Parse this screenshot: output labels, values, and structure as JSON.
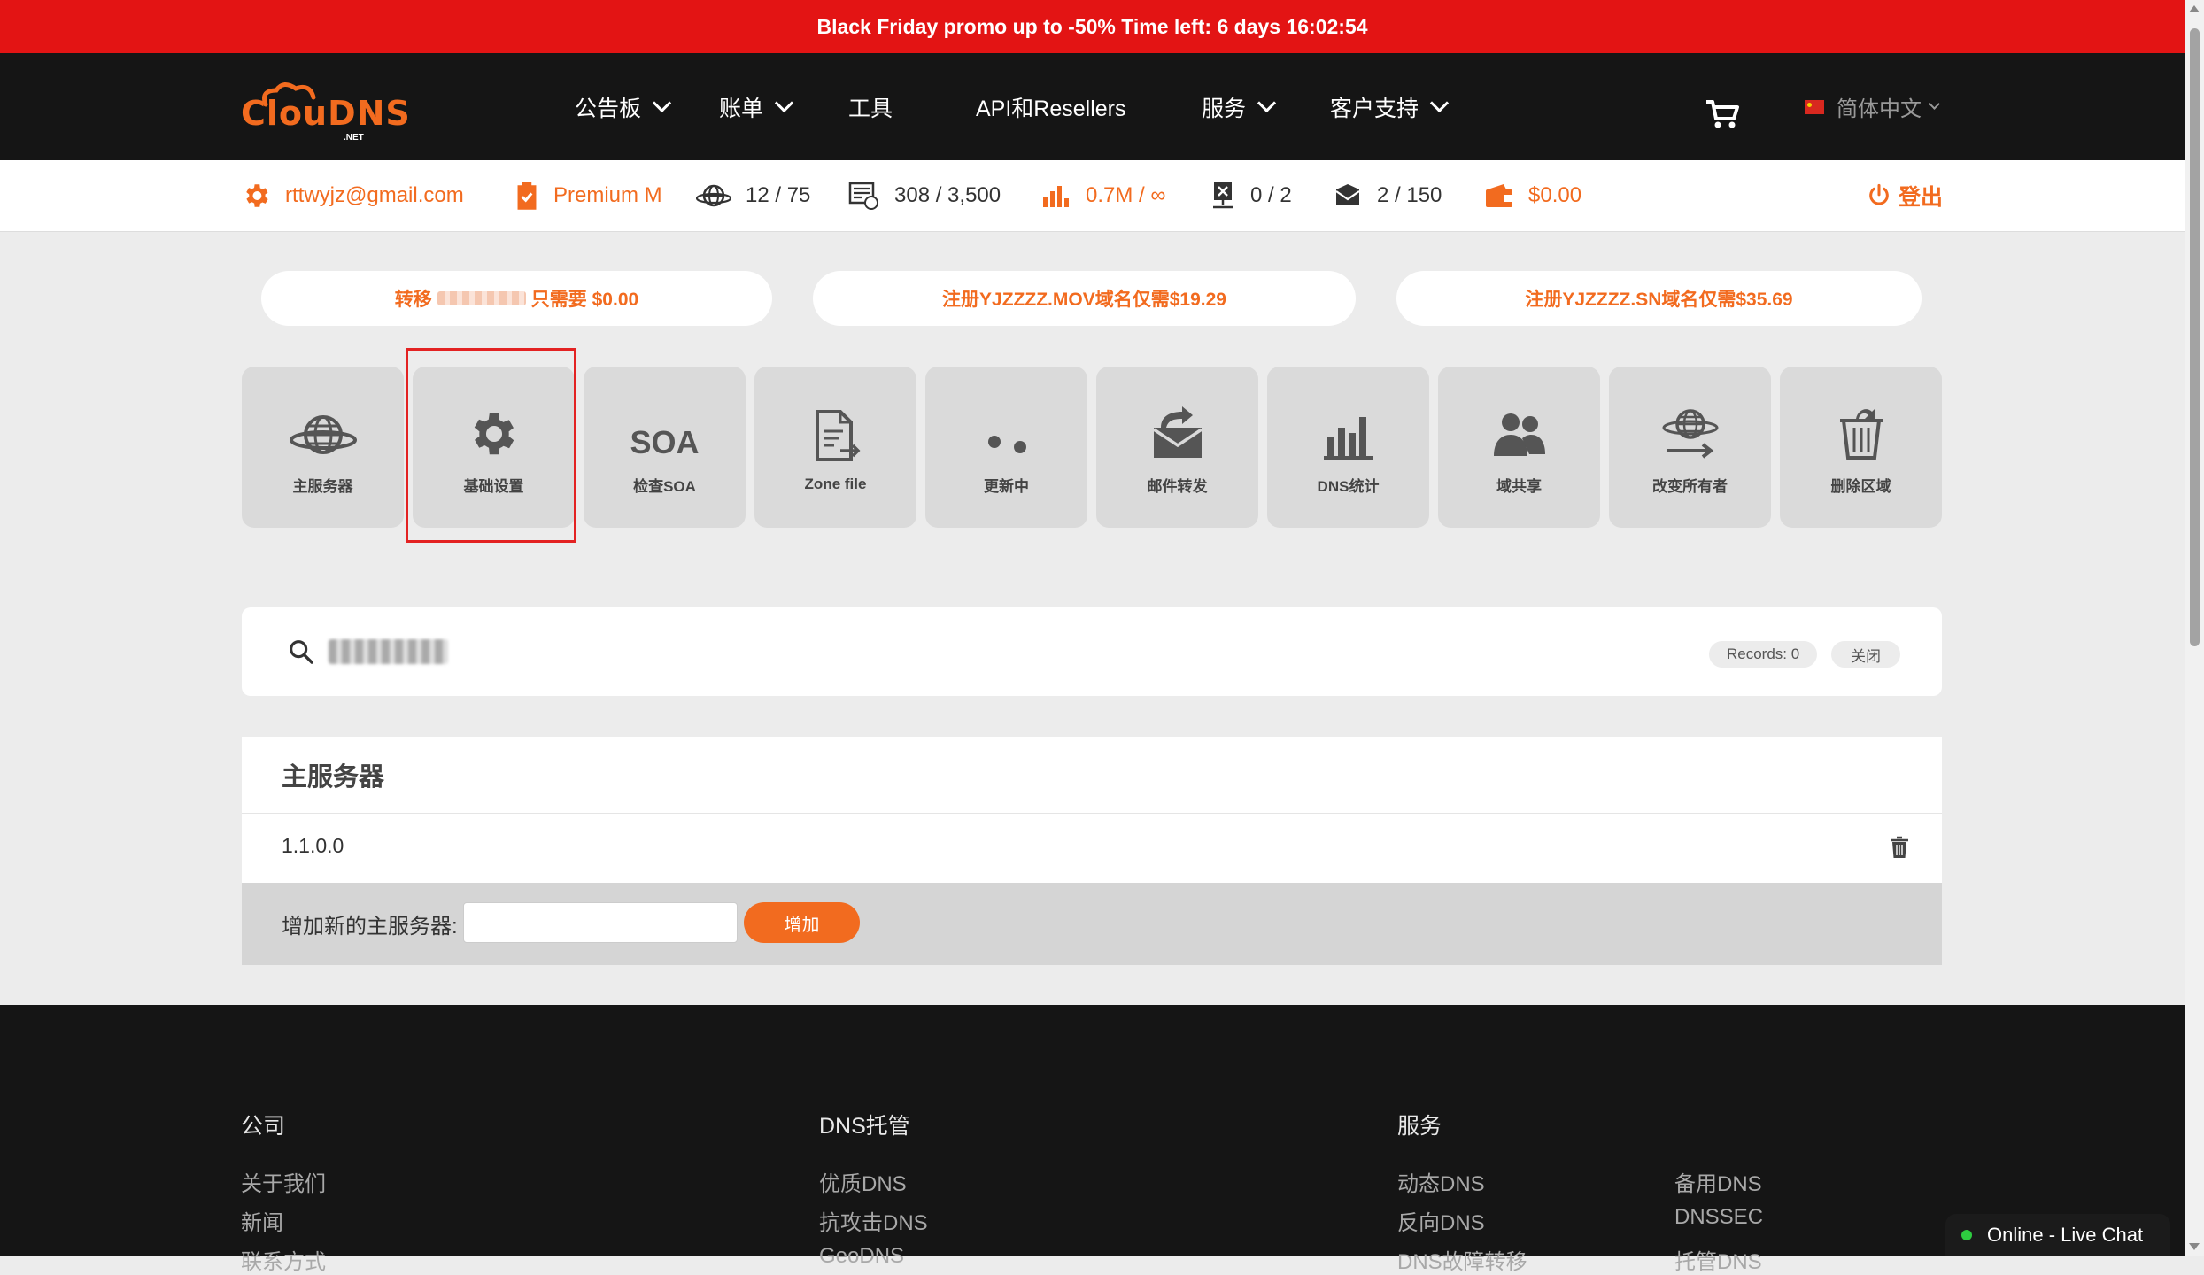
{
  "promo": {
    "text": "Black Friday promo up to -50% Time left: 6 days 16:02:54"
  },
  "logo": {
    "text": "ClouDNS",
    "sub": ".NET"
  },
  "nav": {
    "items": [
      {
        "label": "公告板"
      },
      {
        "label": "账单"
      },
      {
        "label": "工具"
      },
      {
        "label": "API和Resellers"
      },
      {
        "label": "服务"
      },
      {
        "label": "客户支持"
      }
    ],
    "language": "简体中文"
  },
  "stats": {
    "email": "rttwyjz@gmail.com",
    "plan": "Premium M",
    "zones": "12 / 75",
    "records": "308 / 3,500",
    "queries": "0.7M / ∞",
    "failover": "0 / 2",
    "mail_forwards": "2 / 150",
    "balance": "$0.00",
    "logout": "登出"
  },
  "promos": [
    {
      "prefix": "转移",
      "suffix": "只需要 $0.00"
    },
    {
      "text": "注册YJZZZZ.MOV域名仅需$19.29"
    },
    {
      "text": "注册YJZZZZ.SN域名仅需$35.69"
    }
  ],
  "tiles": [
    {
      "label": "主服务器",
      "icon": "globe-network-icon"
    },
    {
      "label": "基础设置",
      "icon": "gear-icon"
    },
    {
      "label": "检查SOA",
      "icon": "soa-text-icon",
      "icon_text": "SOA"
    },
    {
      "label": "Zone file",
      "icon": "zone-file-icon"
    },
    {
      "label": "更新中",
      "icon": "updating-dots-icon"
    },
    {
      "label": "邮件转发",
      "icon": "mail-forward-icon"
    },
    {
      "label": "DNS统计",
      "icon": "bar-stats-icon"
    },
    {
      "label": "域共享",
      "icon": "users-share-icon"
    },
    {
      "label": "改变所有者",
      "icon": "globe-transfer-icon"
    },
    {
      "label": "删除区域",
      "icon": "delete-bin-icon"
    }
  ],
  "search": {
    "records": "Records: 0",
    "close": "关闭"
  },
  "master_panel": {
    "title": "主服务器",
    "servers": [
      "1.1.0.0"
    ],
    "add_label": "增加新的主服务器:",
    "add_button": "增加",
    "input_value": ""
  },
  "footer": {
    "columns": [
      {
        "title": "公司",
        "links": [
          "关于我们",
          "新闻",
          "联系方式"
        ]
      },
      {
        "title": "DNS托管",
        "links": [
          "优质DNS",
          "抗攻击DNS",
          "GeoDNS"
        ]
      },
      {
        "title": "服务",
        "links": [
          "动态DNS",
          "反向DNS",
          "DNS故障转移"
        ]
      },
      {
        "title": "",
        "links": [
          "备用DNS",
          "DNSSEC",
          "托管DNS"
        ]
      }
    ]
  },
  "chat": {
    "text": "Online - Live Chat"
  },
  "colors": {
    "accent": "#f26b1f",
    "promo_bg": "#e31414",
    "nav_bg": "#151515",
    "selection": "#e32222"
  }
}
